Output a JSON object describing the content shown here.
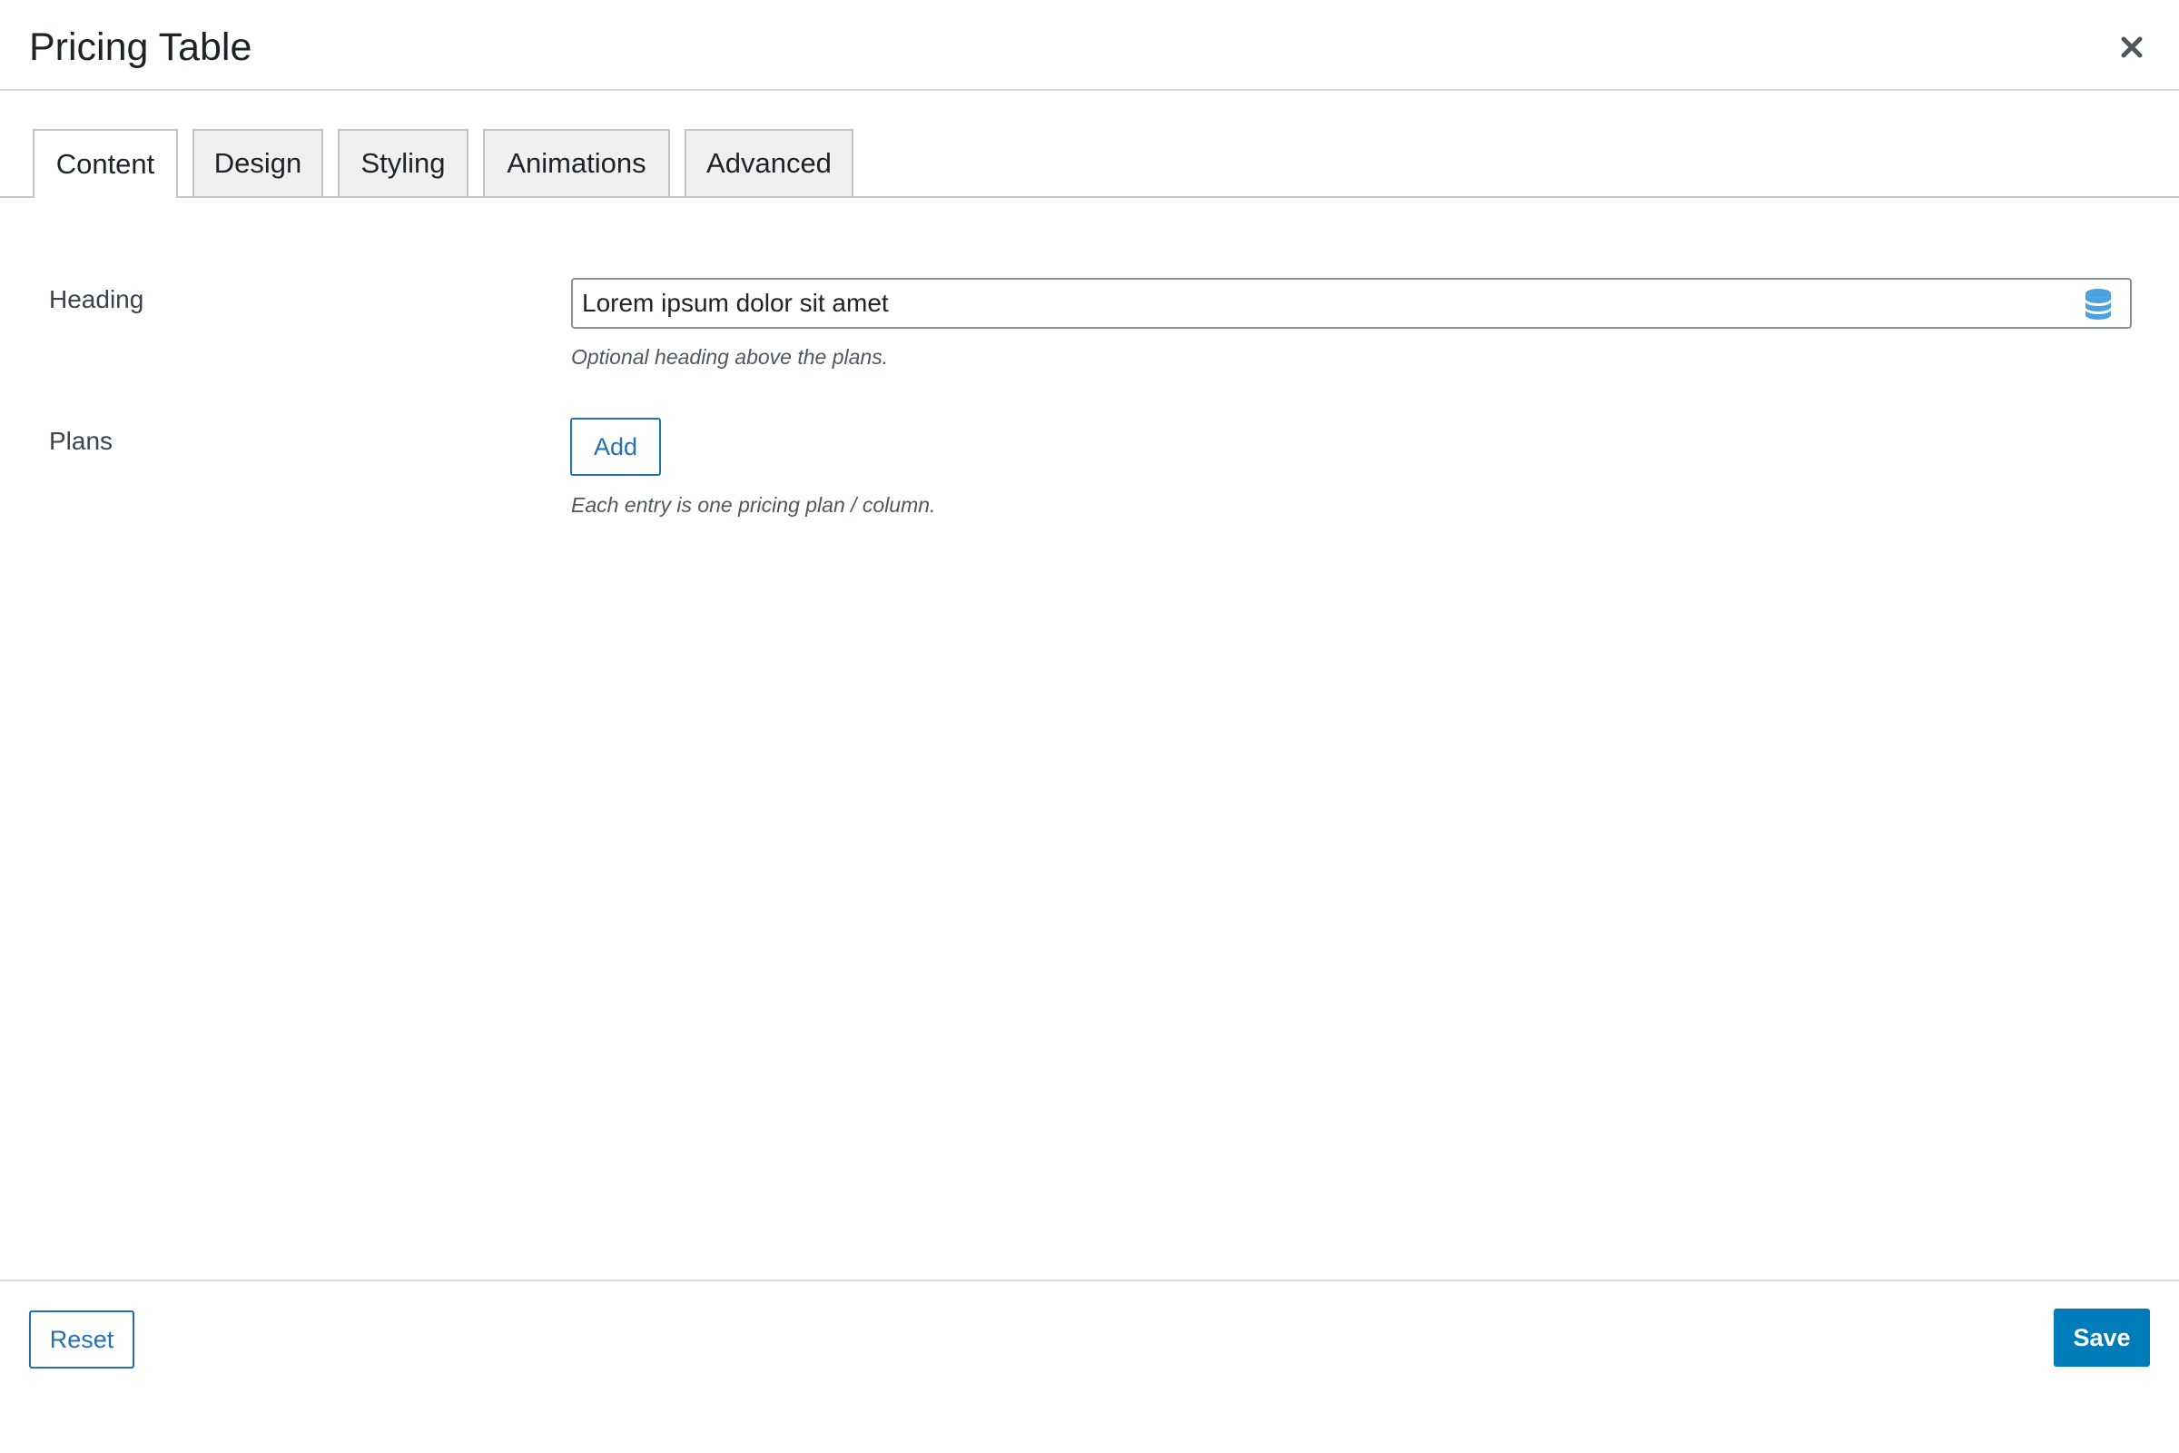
{
  "dialog": {
    "title": "Pricing Table",
    "close_icon": "close-icon"
  },
  "tabs": [
    {
      "label": "Content",
      "active": true
    },
    {
      "label": "Design",
      "active": false
    },
    {
      "label": "Styling",
      "active": false
    },
    {
      "label": "Animations",
      "active": false
    },
    {
      "label": "Advanced",
      "active": false
    }
  ],
  "fields": {
    "heading": {
      "label": "Heading",
      "value": "Lorem ipsum dolor sit amet",
      "description": "Optional heading above the plans.",
      "icon": "database-icon"
    },
    "plans": {
      "label": "Plans",
      "add_label": "Add",
      "description": "Each entry is one pricing plan / column."
    }
  },
  "footer": {
    "reset_label": "Reset",
    "save_label": "Save"
  },
  "colors": {
    "accent": "#2271b1",
    "save_bg": "#007cba",
    "dynamic_icon": "#4aa3df"
  }
}
